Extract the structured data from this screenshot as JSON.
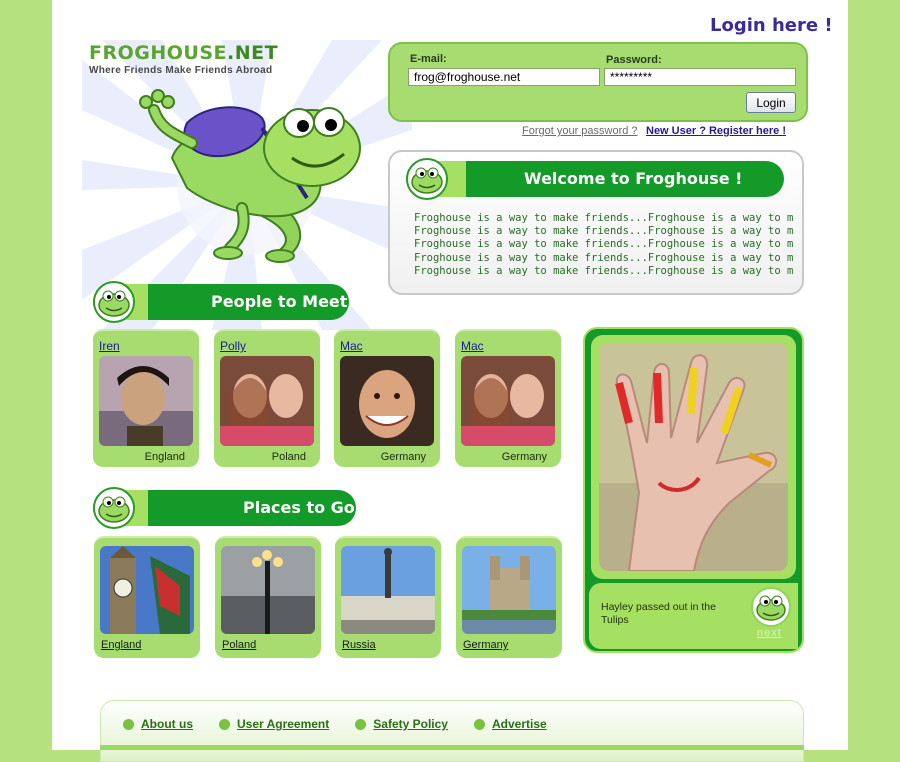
{
  "logo": {
    "name": "FROGHOUSE",
    "tld": ".NET",
    "tagline": "Where Friends Make Friends Abroad"
  },
  "login": {
    "heading": "Login here !",
    "email_label": "E-mail:",
    "email_value": "frog@froghouse.net",
    "password_label": "Password:",
    "password_value": "*********",
    "button": "Login",
    "forgot": "Forgot your password ?",
    "register": "New User ? Register here !"
  },
  "welcome": {
    "title": "Welcome to Froghouse !",
    "lines": [
      "Froghouse is a way to make friends...Froghouse is a way to make",
      "Froghouse is a way to make friends...Froghouse is a way to make",
      "Froghouse is a way to make friends...Froghouse is a way to make",
      "Froghouse is a way to make friends...Froghouse is a way to make",
      "Froghouse is a way to make friends...Froghouse is a way to make"
    ]
  },
  "people": {
    "title": "People to Meet !",
    "items": [
      {
        "name": "Iren",
        "country": "England"
      },
      {
        "name": "Polly",
        "country": "Poland"
      },
      {
        "name": "Mac",
        "country": "Germany"
      },
      {
        "name": "Mac",
        "country": "Germany"
      }
    ]
  },
  "places": {
    "title": "Places to Go!",
    "items": [
      {
        "name": "England"
      },
      {
        "name": "Poland"
      },
      {
        "name": "Russia"
      },
      {
        "name": "Germany"
      }
    ]
  },
  "featured": {
    "caption": "Hayley passed out in the Tulips",
    "next": "next"
  },
  "footer": {
    "links": [
      "About us",
      "User Agreement",
      "Safety Policy",
      "Advertise"
    ]
  },
  "colors": {
    "background": "#b5e27e",
    "brand_green": "#149a28",
    "light_green": "#a7dd70",
    "link_purple": "#3d2a9a"
  }
}
